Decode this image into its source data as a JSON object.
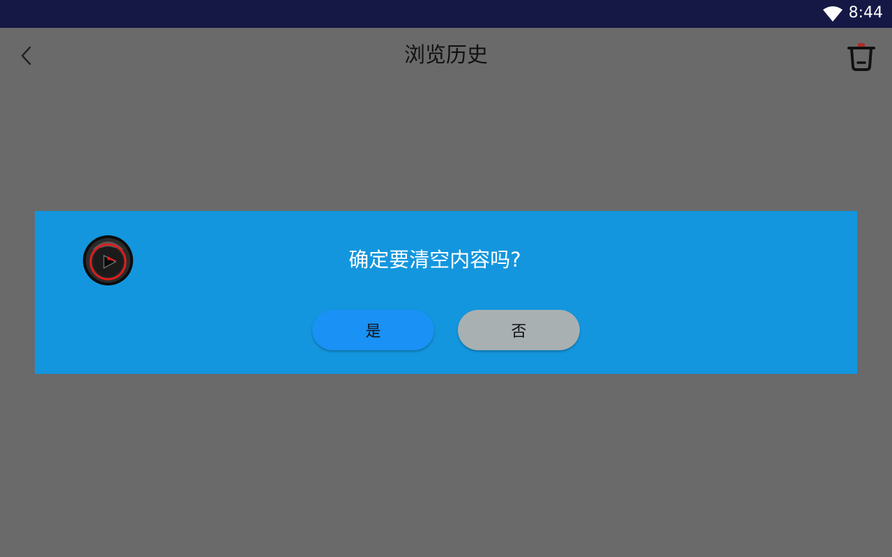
{
  "status_bar": {
    "time": "8:44",
    "icons": [
      "wifi-icon"
    ]
  },
  "app_bar": {
    "back_icon": "chevron-left-icon",
    "title": "浏览历史",
    "trash_icon": "trash-icon"
  },
  "dialog": {
    "logo_icon": "player-logo-icon",
    "message": "确定要清空内容吗?",
    "confirm_label": "是",
    "cancel_label": "否"
  },
  "colors": {
    "status_bar": "#151845",
    "overlay_background": "#6a6a6a",
    "dialog_background": "#1396dd",
    "confirm_button": "#1991f5",
    "cancel_button": "#a8b0b2"
  }
}
